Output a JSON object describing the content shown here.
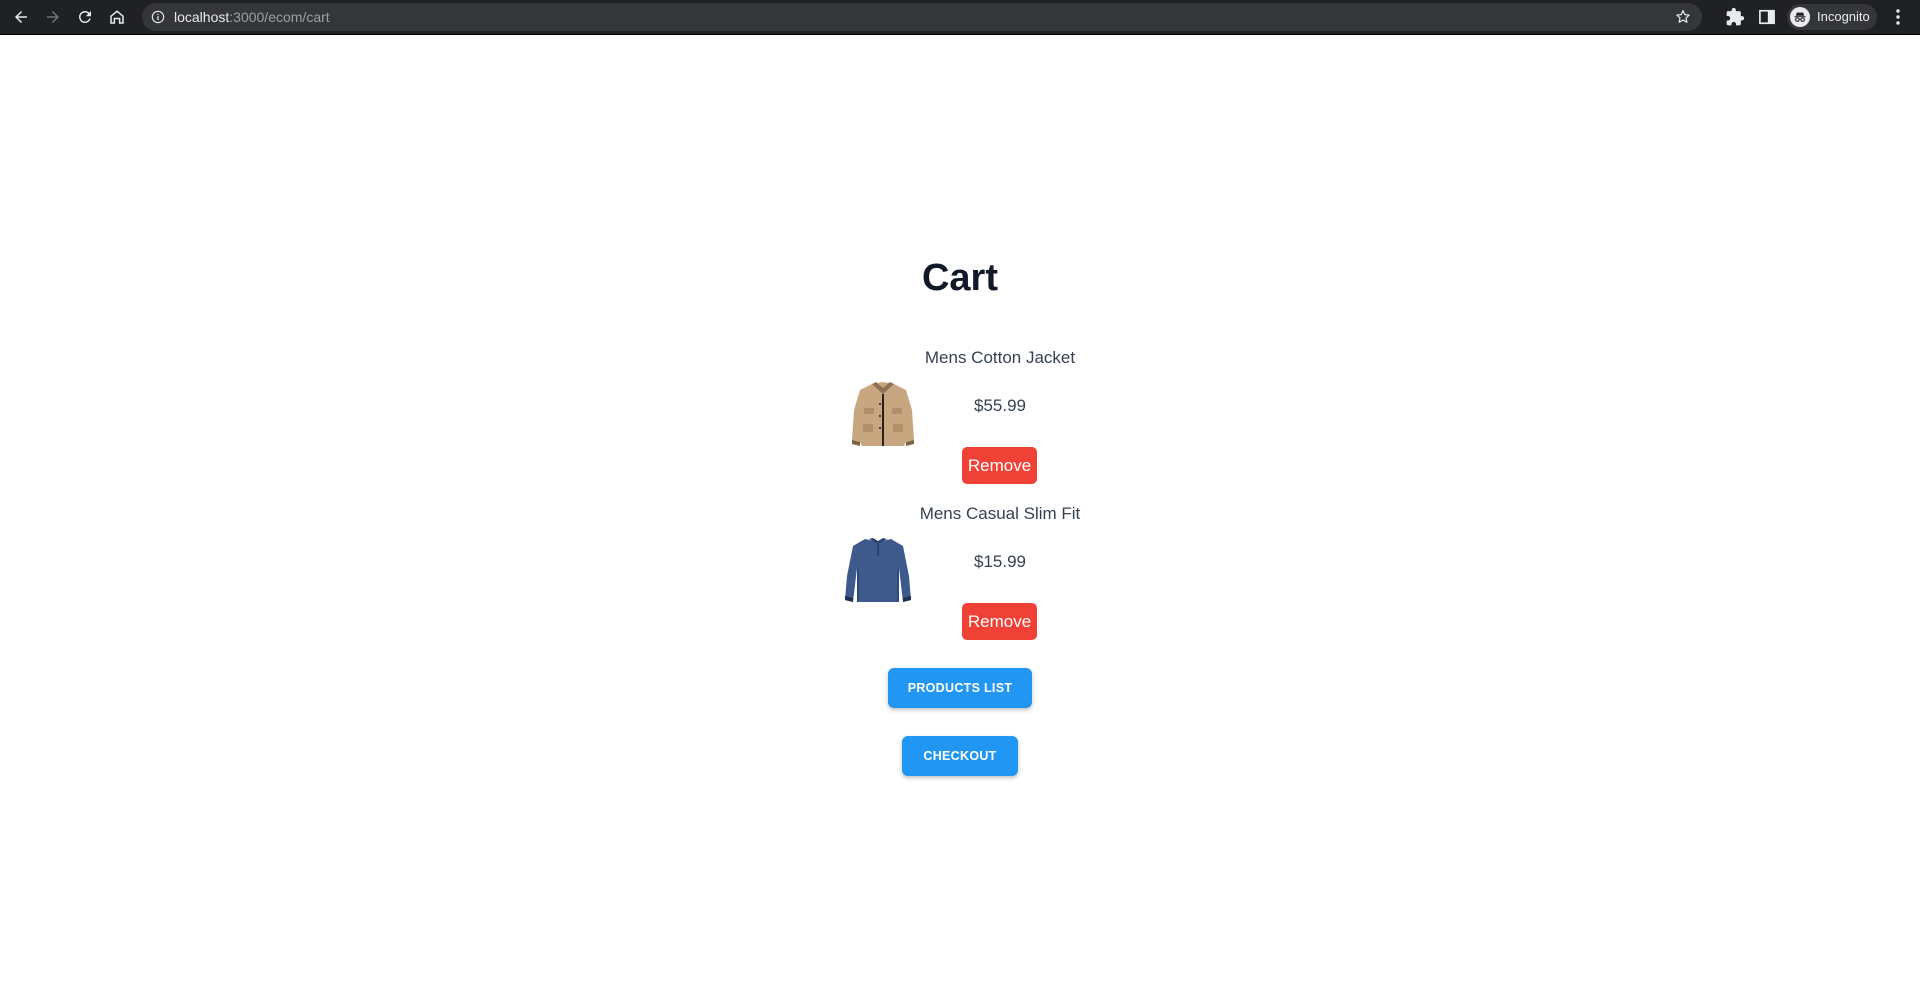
{
  "browser": {
    "url_host": "localhost",
    "url_rest": ":3000/ecom/cart",
    "profile_label": "Incognito",
    "icons": [
      "back-arrow-icon",
      "forward-arrow-icon",
      "reload-icon",
      "home-icon",
      "info-icon",
      "star-icon",
      "extensions-puzzle-icon",
      "side-panel-icon",
      "incognito-icon",
      "menu-dots-icon"
    ]
  },
  "page": {
    "title": "Cart"
  },
  "cart": {
    "items": [
      {
        "name": "Mens Cotton Jacket",
        "price": "$55.99",
        "remove_label": "Remove",
        "image": "jacket-image"
      },
      {
        "name": "Mens Casual Slim Fit",
        "price": "$15.99",
        "remove_label": "Remove",
        "image": "shirt-image"
      }
    ]
  },
  "actions": {
    "products_list_label": "PRODUCTS LIST",
    "checkout_label": "CHECKOUT"
  },
  "colors": {
    "chrome_bg": "#202124",
    "remove_button": "#ef4136",
    "action_button": "#2196f3",
    "title_text": "#111827"
  }
}
